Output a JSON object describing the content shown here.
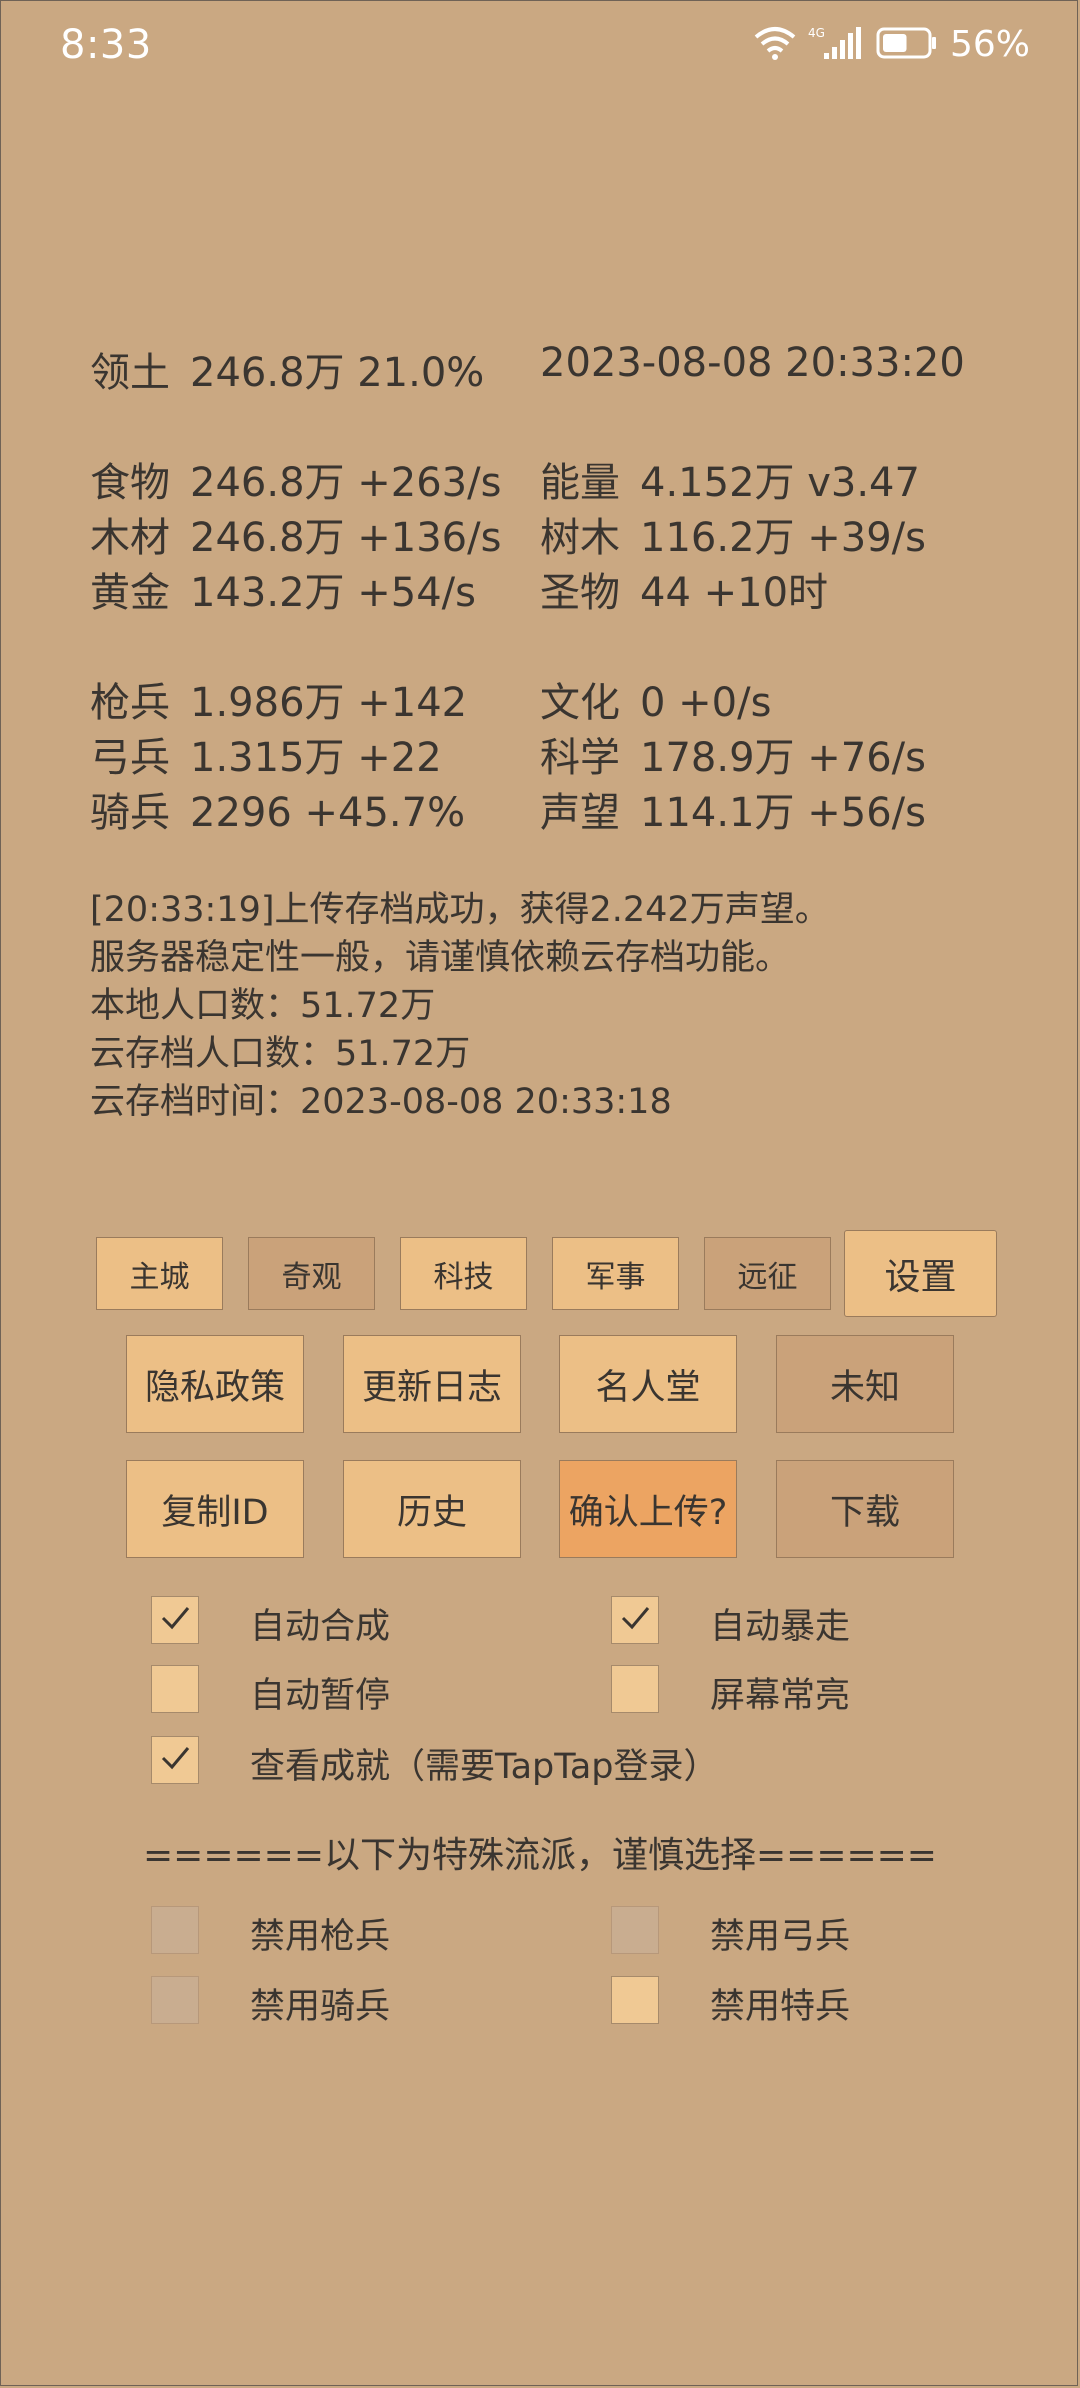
{
  "status_bar": {
    "time": "8:33",
    "network": "4G",
    "battery": "56%",
    "battery_level": 0.56
  },
  "stats": {
    "territory": {
      "label": "领土",
      "value": "246.8万  21.0%"
    },
    "datetime": "2023-08-08 20:33:20",
    "left": [
      {
        "label": "食物",
        "value": "246.8万 +263/s"
      },
      {
        "label": "木材",
        "value": "246.8万 +136/s"
      },
      {
        "label": "黄金",
        "value": "143.2万 +54/s"
      },
      {
        "label": "枪兵",
        "value": "1.986万 +142"
      },
      {
        "label": "弓兵",
        "value": "1.315万 +22"
      },
      {
        "label": "骑兵",
        "value": "2296 +45.7%"
      }
    ],
    "right": [
      {
        "label": "能量",
        "value": "4.152万  v3.47"
      },
      {
        "label": "树木",
        "value": "116.2万 +39/s"
      },
      {
        "label": "圣物",
        "value": "44 +10时"
      },
      {
        "label": "文化",
        "value": "0 +0/s"
      },
      {
        "label": "科学",
        "value": "178.9万 +76/s"
      },
      {
        "label": "声望",
        "value": "114.1万 +56/s"
      }
    ]
  },
  "log": [
    "[20:33:19]上传存档成功，获得2.242万声望。",
    "服务器稳定性一般，请谨慎依赖云存档功能。",
    "本地人口数：51.72万",
    "云存档人口数：51.72万",
    "云存档时间：2023-08-08 20:33:18"
  ],
  "tabs": [
    "主城",
    "奇观",
    "科技",
    "军事",
    "远征"
  ],
  "settings_label": "设置",
  "buttons_row1": [
    "隐私政策",
    "更新日志",
    "名人堂",
    "未知"
  ],
  "buttons_row2": [
    "复制ID",
    "历史",
    "确认上传?",
    "下载"
  ],
  "options": {
    "auto_compose": {
      "label": "自动合成",
      "checked": true
    },
    "auto_rush": {
      "label": "自动暴走",
      "checked": true
    },
    "auto_pause": {
      "label": "自动暂停",
      "checked": false
    },
    "screen_on": {
      "label": "屏幕常亮",
      "checked": false
    },
    "achievements": {
      "label": "查看成就（需要TapTap登录）",
      "checked": true
    }
  },
  "special_divider": "======以下为特殊流派，谨慎选择======",
  "special_options": {
    "disable_spear": {
      "label": "禁用枪兵",
      "checked": false
    },
    "disable_archer": {
      "label": "禁用弓兵",
      "checked": false
    },
    "disable_cavalry": {
      "label": "禁用骑兵",
      "checked": false
    },
    "disable_special": {
      "label": "禁用特兵",
      "checked": false
    }
  },
  "colors": {
    "background": "#caa882",
    "button_light": "#ecbf86",
    "button_dark": "#caa27a",
    "button_highlight": "#eca462",
    "text": "#3a3530"
  }
}
